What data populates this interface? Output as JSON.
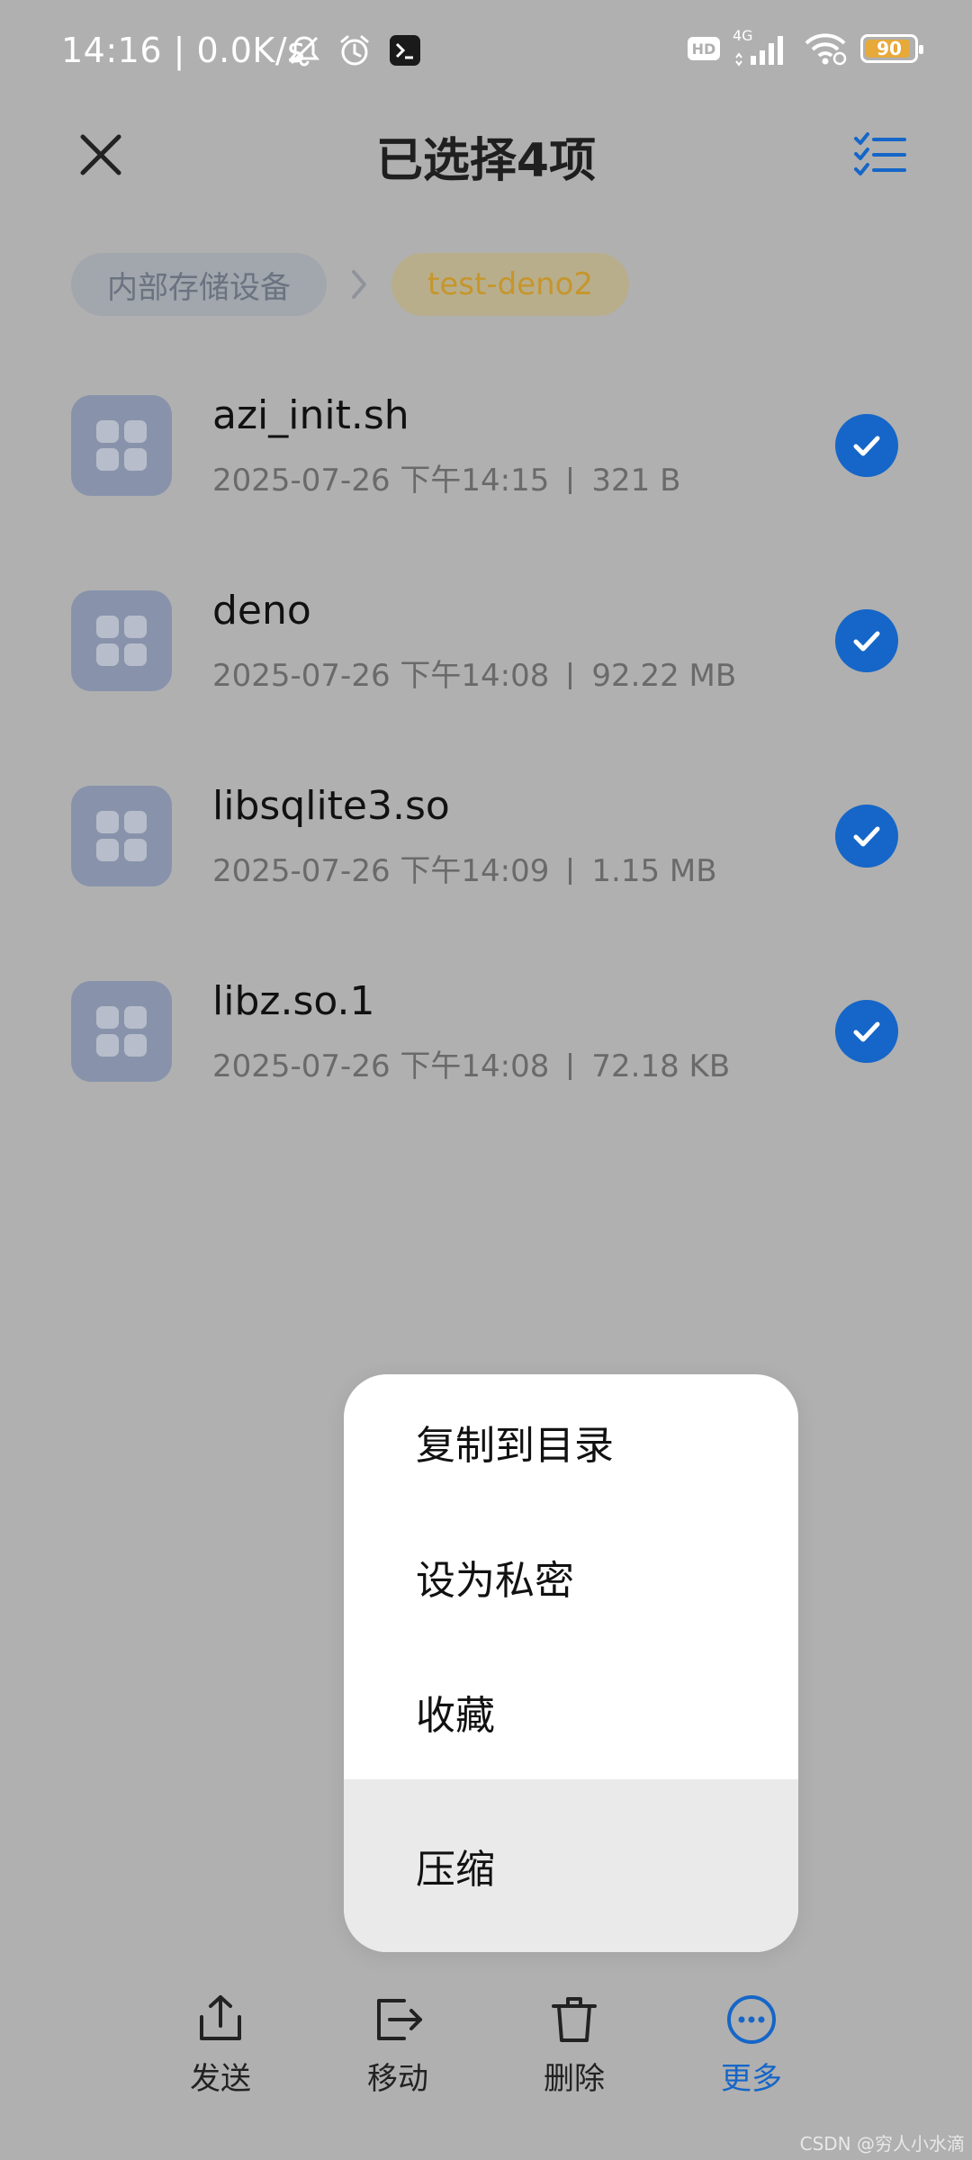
{
  "status_bar": {
    "time_speed": "14:16 | 0.0K/s",
    "hd_label": "HD",
    "network_label": "4G",
    "battery_level": "90",
    "battery_fraction": 0.9,
    "battery_color": "#e7a93a",
    "icons": [
      "mute-icon",
      "alarm-icon",
      "terminal-icon",
      "hd-icon",
      "signal-icon",
      "wifi-icon",
      "battery-icon"
    ]
  },
  "header": {
    "title": "已选择4项",
    "close_icon": "close-icon",
    "select_all_icon": "checklist-icon"
  },
  "breadcrumb": {
    "root": "内部存储设备",
    "current": "test-deno2"
  },
  "files": [
    {
      "name": "azi_init.sh",
      "date": "2025-07-26 下午14:15",
      "size": "321 B",
      "selected": true
    },
    {
      "name": "deno",
      "date": "2025-07-26 下午14:08",
      "size": "92.22 MB",
      "selected": true
    },
    {
      "name": "libsqlite3.so",
      "date": "2025-07-26 下午14:09",
      "size": "1.15 MB",
      "selected": true
    },
    {
      "name": "libz.so.1",
      "date": "2025-07-26 下午14:08",
      "size": "72.18 KB",
      "selected": true
    }
  ],
  "popup_menu": {
    "items": [
      {
        "label": "复制到目录"
      },
      {
        "label": "设为私密"
      },
      {
        "label": "收藏"
      },
      {
        "label": "压缩"
      }
    ],
    "highlighted": "压缩"
  },
  "toolbar": {
    "items": [
      {
        "label": "发送",
        "icon": "share-icon"
      },
      {
        "label": "移动",
        "icon": "move-icon"
      },
      {
        "label": "删除",
        "icon": "trash-icon"
      },
      {
        "label": "更多",
        "icon": "more-icon"
      }
    ],
    "active": "更多"
  },
  "colors": {
    "accent": "#1566c8",
    "overlay_background": "#b0b0b0",
    "breadcrumb_current": "#c6962b"
  },
  "watermark": "CSDN @穷人小水滴"
}
